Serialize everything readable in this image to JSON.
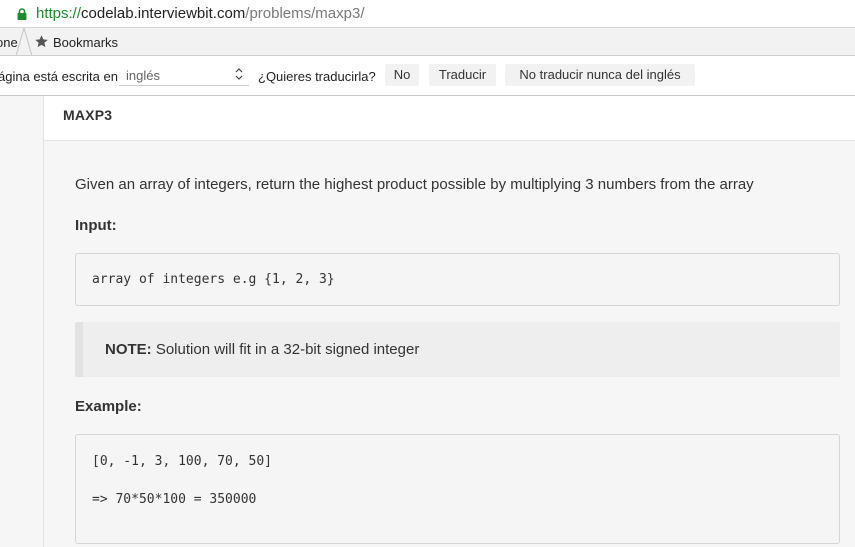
{
  "address_bar": {
    "url_scheme": "https://",
    "url_host": "codelab.interviewbit.com",
    "url_path": "/problems/maxp3/"
  },
  "bookmarks_bar": {
    "partial_item": "one",
    "bookmarks_label": "Bookmarks"
  },
  "translate_bar": {
    "prefix": "ágina está escrita en",
    "language": "inglés",
    "question": "¿Quieres traducirla?",
    "no_button": "No",
    "translate_button": "Traducir",
    "never_button": "No traducir nunca del inglés"
  },
  "problem": {
    "title": "MAXP3",
    "description": "Given an array of integers, return the highest product possible by multiplying 3 numbers from the array",
    "input_label": "Input:",
    "input_code": "array of integers e.g {1, 2, 3}",
    "note_label": "NOTE:",
    "note_text": " Solution will fit in a 32-bit signed integer",
    "example_label": "Example:",
    "example_line1": "[0, -1, 3, 100, 70, 50]",
    "example_line2": "=> 70*50*100 = 350000"
  },
  "colors": {
    "secure_green": "#1c8c2c",
    "panel_bg": "#f6f6f6"
  }
}
